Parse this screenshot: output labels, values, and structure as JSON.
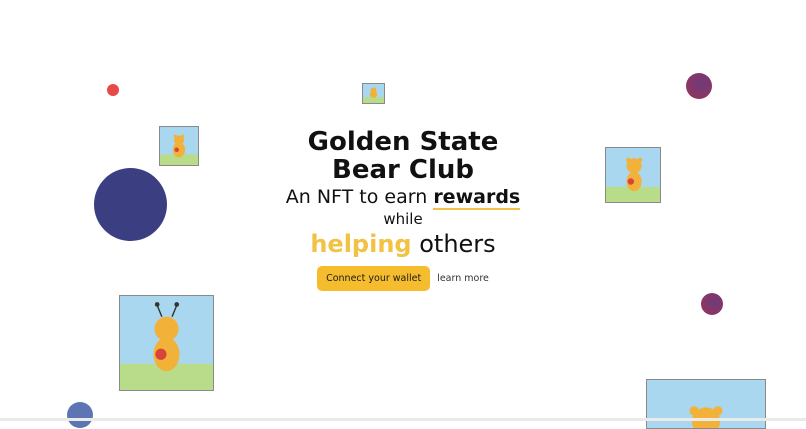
{
  "hero": {
    "title": "Golden State Bear Club",
    "tagline_prefix": "An NFT to earn ",
    "tagline_emphasis": "rewards",
    "tagline_mid": "while",
    "tagline_highlight": "helping",
    "tagline_suffix": " others"
  },
  "actions": {
    "connect_label": "Connect your wallet",
    "learn_label": "learn more"
  },
  "colors": {
    "accent_yellow": "#f5bd2e",
    "navy_bubble": "#3b3f82",
    "plum_bubble": "#7d3560",
    "red_dot": "#e84a4a",
    "blue_bubble": "#5b76b3"
  },
  "decorations": {
    "bubbles": [
      "red-dot",
      "navy-bubble",
      "plum-bubble",
      "plum-bubble",
      "blue-bubble"
    ],
    "cards": [
      "bear-card",
      "bear-card",
      "bear-card",
      "bear-card",
      "bear-card"
    ]
  }
}
